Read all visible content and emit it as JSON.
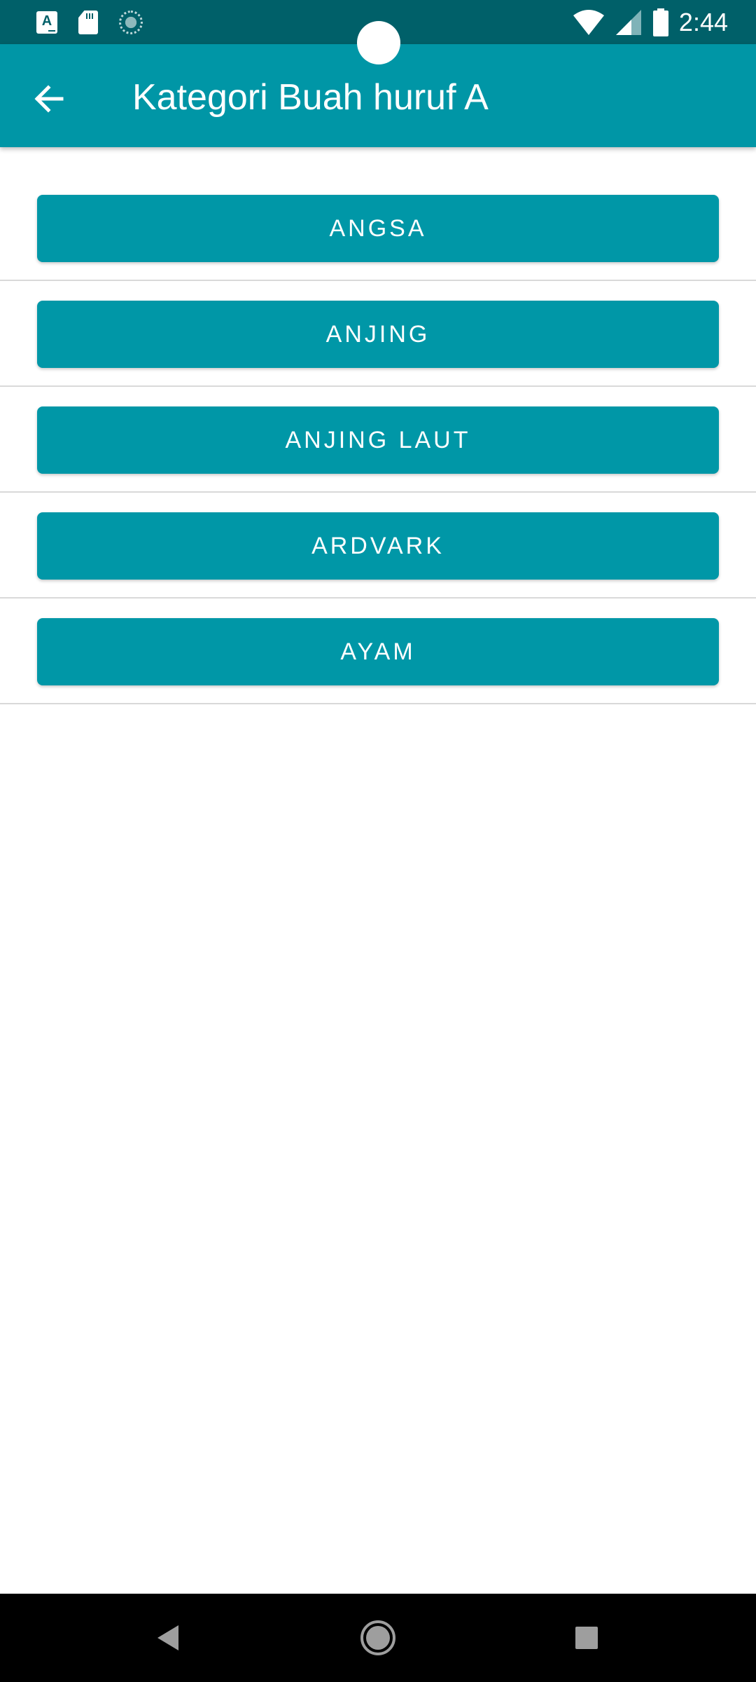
{
  "status_bar": {
    "time": "2:44",
    "left_icons": [
      "font-a-icon",
      "sd-card-icon",
      "sync-icon"
    ],
    "right_icons": [
      "wifi-icon",
      "cell-signal-icon",
      "battery-icon"
    ]
  },
  "app_bar": {
    "back_icon": "arrow-back-icon",
    "title": "Kategori Buah huruf A"
  },
  "list": {
    "items": [
      {
        "label": "ANGSA"
      },
      {
        "label": "ANJING"
      },
      {
        "label": "ANJING LAUT"
      },
      {
        "label": "ARDVARK"
      },
      {
        "label": "AYAM"
      }
    ]
  },
  "nav_bar": {
    "icons": [
      "back-triangle-icon",
      "home-circle-icon",
      "recents-square-icon"
    ]
  },
  "colors": {
    "status_bar": "#006069",
    "app_bar": "#0096a6",
    "button": "#0097a7",
    "nav_bar": "#000000"
  }
}
